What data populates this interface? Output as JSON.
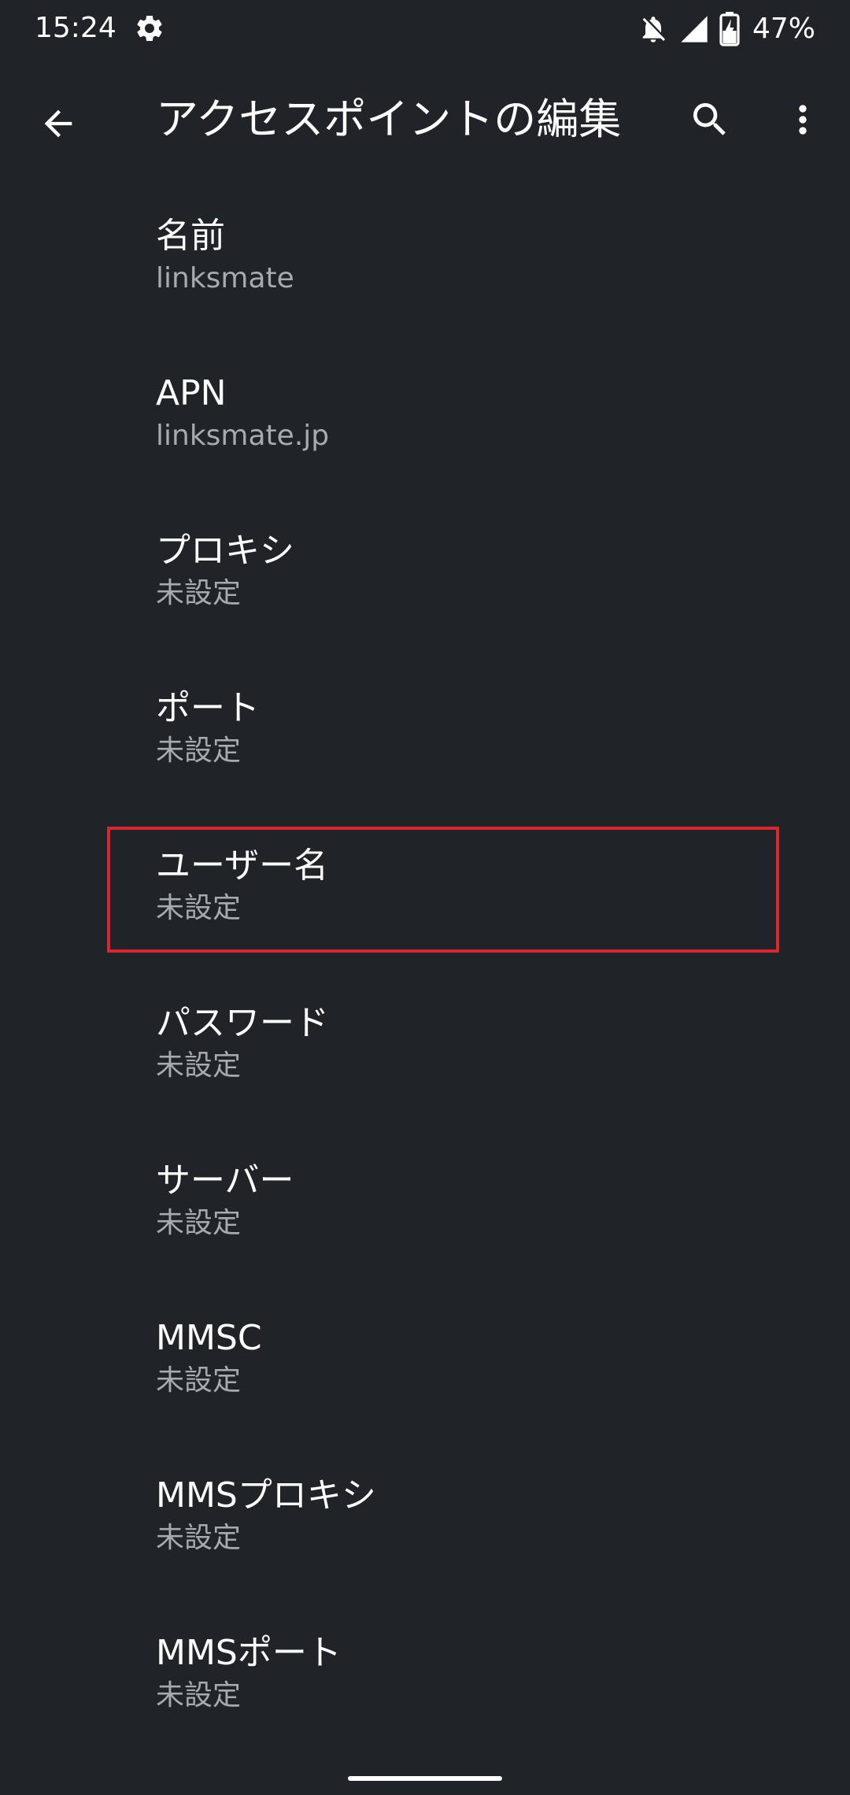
{
  "status_bar": {
    "time": "15:24",
    "battery_percent": "47%",
    "icons": [
      "settings-gear-icon",
      "notifications-off-icon",
      "signal-icon",
      "battery-charging-icon"
    ]
  },
  "app_bar": {
    "title": "アクセスポイントの編集",
    "icons": [
      "back-arrow-icon",
      "search-icon",
      "more-vert-icon"
    ]
  },
  "preferences": [
    {
      "title": "名前",
      "summary": "linksmate"
    },
    {
      "title": "APN",
      "summary": "linksmate.jp"
    },
    {
      "title": "プロキシ",
      "summary": "未設定"
    },
    {
      "title": "ポート",
      "summary": "未設定"
    },
    {
      "title": "ユーザー名",
      "summary": "未設定",
      "highlighted": true
    },
    {
      "title": "パスワード",
      "summary": "未設定"
    },
    {
      "title": "サーバー",
      "summary": "未設定"
    },
    {
      "title": "MMSC",
      "summary": "未設定"
    },
    {
      "title": "MMSプロキシ",
      "summary": "未設定"
    },
    {
      "title": "MMSポート",
      "summary": "未設定"
    }
  ],
  "colors": {
    "background": "#202328",
    "text_primary": "#ffffff",
    "text_secondary": "#a7aaaf",
    "highlight": "#d9262f"
  }
}
